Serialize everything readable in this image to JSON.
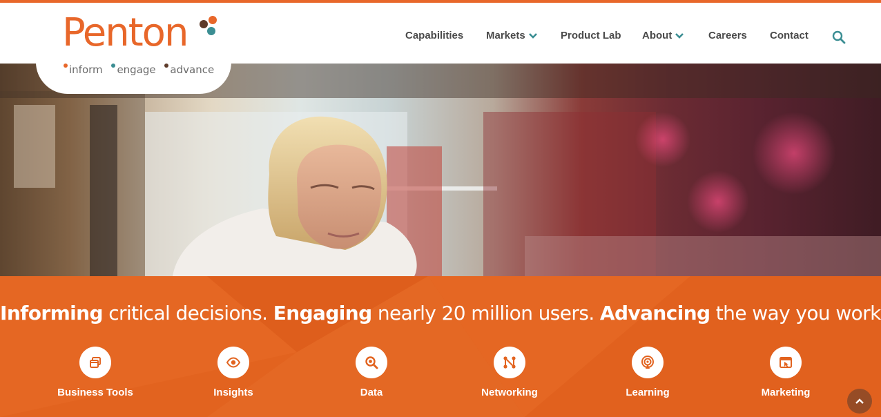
{
  "brand": {
    "name": "Penton",
    "tagline": [
      "inform",
      "engage",
      "advance"
    ],
    "accent_color": "#e8672a",
    "teal_color": "#3b8e93",
    "dark_color": "#5e3b2a"
  },
  "nav": {
    "items": [
      {
        "label": "Capabilities",
        "has_dropdown": false
      },
      {
        "label": "Markets",
        "has_dropdown": true
      },
      {
        "label": "Product Lab",
        "has_dropdown": false
      },
      {
        "label": "About",
        "has_dropdown": true
      },
      {
        "label": "Careers",
        "has_dropdown": false
      },
      {
        "label": "Contact",
        "has_dropdown": false
      }
    ],
    "search_icon": "search-icon"
  },
  "hero": {
    "image_alt": "photo-of-woman-in-laboratory"
  },
  "banner": {
    "background_color": "#e2631f",
    "headline": {
      "part1_bold": "Informing",
      "part1_rest": " critical decisions. ",
      "part2_bold": "Engaging",
      "part2_rest": " nearly 20 million users. ",
      "part3_bold": "Advancing",
      "part3_rest": " the way you work."
    },
    "features": [
      {
        "label": "Business Tools",
        "icon": "windows-icon"
      },
      {
        "label": "Insights",
        "icon": "eye-icon"
      },
      {
        "label": "Data",
        "icon": "magnifier-icon"
      },
      {
        "label": "Networking",
        "icon": "network-icon"
      },
      {
        "label": "Learning",
        "icon": "broadcast-icon"
      },
      {
        "label": "Marketing",
        "icon": "browser-cursor-icon"
      }
    ]
  },
  "back_to_top_icon": "chevron-up-icon"
}
